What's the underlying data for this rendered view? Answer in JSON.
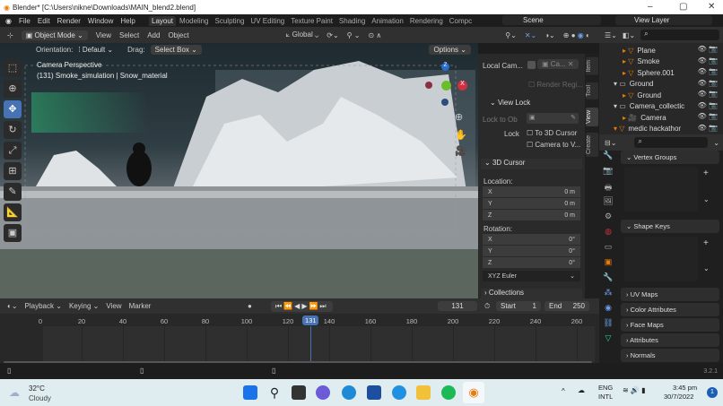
{
  "window": {
    "title": "Blender* [C:\\Users\\nikne\\Downloads\\MAIN_blend2.blend]"
  },
  "menu": [
    "File",
    "Edit",
    "Render",
    "Window",
    "Help"
  ],
  "workspaces": [
    "Layout",
    "Modeling",
    "Sculpting",
    "UV Editing",
    "Texture Paint",
    "Shading",
    "Animation",
    "Rendering",
    "Compc"
  ],
  "scene": "Scene",
  "view_layer": "View Layer",
  "header": {
    "mode": "Object Mode",
    "view": "View",
    "select": "Select",
    "add": "Add",
    "object": "Object",
    "transform": "Global",
    "orientation_label": "Orientation:",
    "orientation": "Default",
    "drag_label": "Drag:",
    "drag": "Select Box",
    "options": "Options"
  },
  "viewport": {
    "line1": "Camera Perspective",
    "line2": "(131) Smoke_simulation | Snow_material"
  },
  "npanel": {
    "tabs": [
      "Item",
      "Tool",
      "View",
      "Create"
    ],
    "local_camera": "Local Cam...",
    "camera_field": "Ca...",
    "render_region": "Render Regi...",
    "view_lock": "View Lock",
    "lock_to_object": "Lock to Ob",
    "lock": "Lock",
    "to_3d_cursor": "To 3D Cursor",
    "camera_to_view": "Camera to V...",
    "cursor_title": "3D Cursor",
    "location": "Location:",
    "rotation": "Rotation:",
    "loc": [
      {
        "axis": "X",
        "value": "0 m"
      },
      {
        "axis": "Y",
        "value": "0 m"
      },
      {
        "axis": "Z",
        "value": "0 m"
      }
    ],
    "rot": [
      {
        "axis": "X",
        "value": "0°"
      },
      {
        "axis": "Y",
        "value": "0°"
      },
      {
        "axis": "Z",
        "value": "0°"
      }
    ],
    "rotation_mode": "XYZ Euler",
    "collections": "Collections"
  },
  "outliner": [
    {
      "name": "Plane",
      "indent": 2
    },
    {
      "name": "Smoke",
      "indent": 2
    },
    {
      "name": "Sphere.001",
      "indent": 2
    },
    {
      "name": "Ground",
      "indent": 1
    },
    {
      "name": "Ground",
      "indent": 2
    },
    {
      "name": "Camera_collectic",
      "indent": 1
    },
    {
      "name": "Camera",
      "indent": 2
    },
    {
      "name": "medic hackathor",
      "indent": 1
    }
  ],
  "properties": {
    "sections": [
      "Vertex Groups",
      "Shape Keys",
      "UV Maps",
      "Color Attributes",
      "Face Maps",
      "Attributes",
      "Normals"
    ]
  },
  "timeline": {
    "menus": [
      "Playback",
      "Keying",
      "View",
      "Marker"
    ],
    "current_frame": "131",
    "start_label": "Start",
    "start": "1",
    "end_label": "End",
    "end": "250",
    "ticks": [
      "0",
      "20",
      "40",
      "60",
      "80",
      "100",
      "120",
      "140",
      "160",
      "180",
      "200",
      "220",
      "240",
      "260"
    ],
    "frame_range": [
      0,
      260
    ]
  },
  "status": {
    "version": "3.2.1"
  },
  "taskbar": {
    "temp": "32°C",
    "weather": "Cloudy",
    "lang1": "ENG",
    "lang2": "INTL",
    "time": "3:45 pm",
    "date": "30/7/2022",
    "notifications": "1"
  }
}
